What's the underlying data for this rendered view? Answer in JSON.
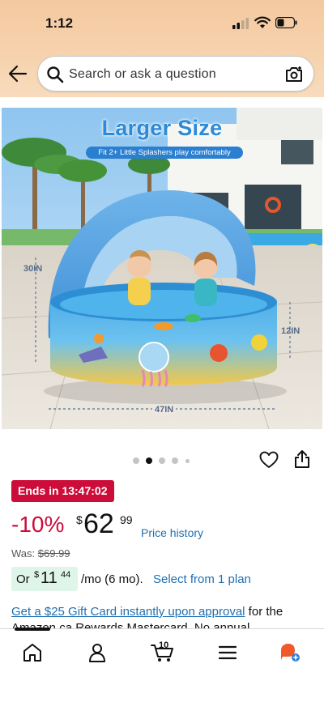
{
  "status_bar": {
    "time": "1:12"
  },
  "search": {
    "placeholder": "Search or ask a question"
  },
  "product_image": {
    "headline": "Larger Size",
    "subline": "Fit 2+ Little Splashers play comfortably",
    "dim_height": "30IN",
    "dim_depth": "12IN",
    "dim_width": "47IN",
    "image_count": 5,
    "active_index": 1
  },
  "deal": {
    "badge": "Ends in 13:47:02"
  },
  "price": {
    "discount": "-10%",
    "currency": "$",
    "whole": "62",
    "fraction": "99",
    "history_link": "Price history",
    "was_label": "Was:",
    "was_value": "$69.99"
  },
  "monthly": {
    "prefix": "Or",
    "currency": "$",
    "whole": "11",
    "fraction": "44",
    "suffix": "/mo (6 mo).",
    "plan_link": "Select from 1 plan"
  },
  "giftcard": {
    "link": "Get a $25 Gift Card instantly upon approval",
    "text": " for the Amazon.ca Rewards Mastercard. No annual"
  },
  "bottom_nav": {
    "cart_count": "10",
    "items": [
      "home",
      "account",
      "cart",
      "menu",
      "rufus"
    ]
  },
  "colors": {
    "deal_red": "#cc0c39",
    "link_blue": "#1f6fb2",
    "header_peach": "#f4c9a0",
    "monthly_green": "#dff5ea"
  }
}
